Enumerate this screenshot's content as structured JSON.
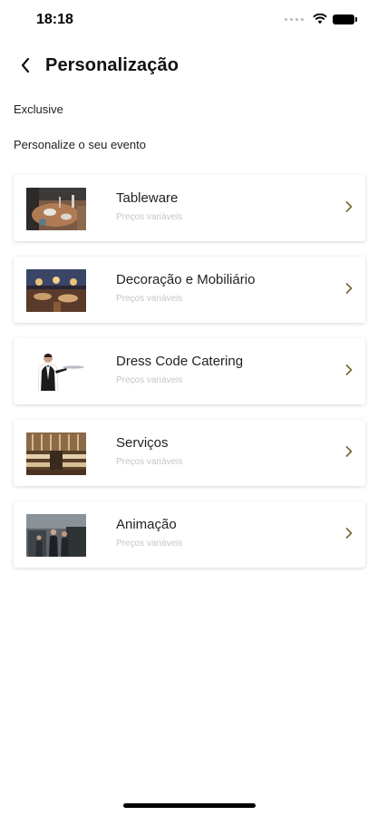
{
  "status_bar": {
    "time": "18:18"
  },
  "header": {
    "title": "Personalização"
  },
  "brand_label": "Exclusive",
  "section_title": "Personalize o seu evento",
  "items": [
    {
      "title": "Tableware",
      "subtitle": "Preços variáveis",
      "thumbnail": "table-setting-photo"
    },
    {
      "title": "Decoração e Mobiliário",
      "subtitle": "Preços variáveis",
      "thumbnail": "decorated-hall-photo"
    },
    {
      "title": "Dress Code Catering",
      "subtitle": "Preços variáveis",
      "thumbnail": "waiter-photo"
    },
    {
      "title": "Serviços",
      "subtitle": "Preços variáveis",
      "thumbnail": "banquet-hall-photo"
    },
    {
      "title": "Animação",
      "subtitle": "Preços variáveis",
      "thumbnail": "performers-photo"
    }
  ],
  "colors": {
    "chevron": "#7a6a3c",
    "subtitle": "#c6c6c6",
    "background": "#ffffff"
  }
}
